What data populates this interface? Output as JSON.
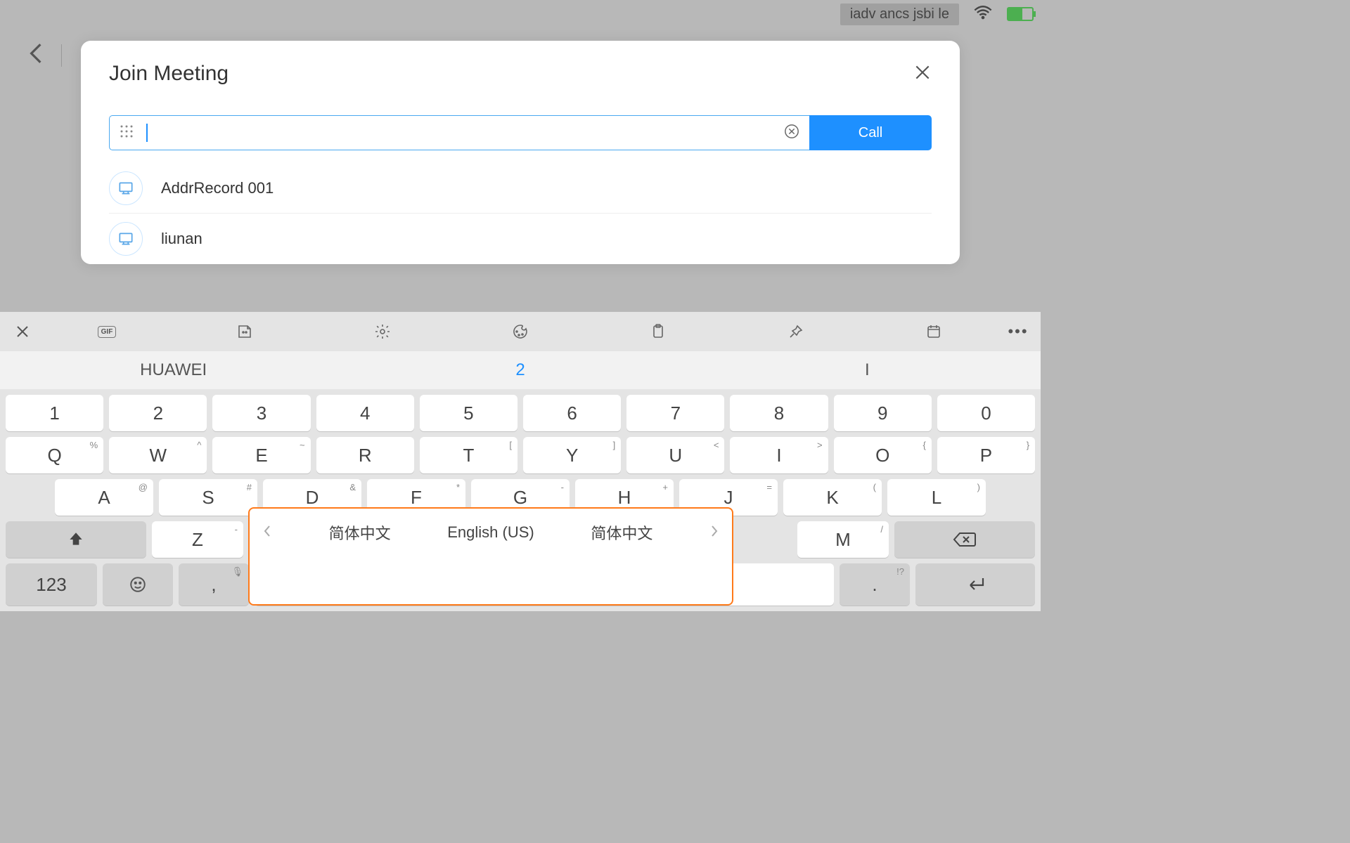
{
  "status": {
    "pill_text": "iadv ancs jsbi le"
  },
  "modal": {
    "title": "Join Meeting",
    "call_label": "Call",
    "contacts": [
      {
        "name": "AddrRecord 001"
      },
      {
        "name": "liunan"
      }
    ]
  },
  "keyboard": {
    "gif_label": "GIF",
    "suggestions": [
      "HUAWEI",
      "2",
      "I"
    ],
    "row_numbers": [
      "1",
      "2",
      "3",
      "4",
      "5",
      "6",
      "7",
      "8",
      "9",
      "0"
    ],
    "row_qwerty": [
      {
        "main": "Q",
        "sup": "%"
      },
      {
        "main": "W",
        "sup": "^"
      },
      {
        "main": "E",
        "sup": "~"
      },
      {
        "main": "R",
        "sup": ""
      },
      {
        "main": "T",
        "sup": "["
      },
      {
        "main": "Y",
        "sup": "]"
      },
      {
        "main": "U",
        "sup": "<"
      },
      {
        "main": "I",
        "sup": ">"
      },
      {
        "main": "O",
        "sup": "{"
      },
      {
        "main": "P",
        "sup": "}"
      }
    ],
    "row_asdf": [
      {
        "main": "A",
        "sup": "@"
      },
      {
        "main": "S",
        "sup": "#"
      },
      {
        "main": "D",
        "sup": "&"
      },
      {
        "main": "F",
        "sup": "*"
      },
      {
        "main": "G",
        "sup": "-"
      },
      {
        "main": "H",
        "sup": "+"
      },
      {
        "main": "J",
        "sup": "="
      },
      {
        "main": "K",
        "sup": "("
      },
      {
        "main": "L",
        "sup": ")"
      }
    ],
    "z_key": {
      "main": "Z",
      "sup": "-"
    },
    "m_key": {
      "main": "M",
      "sup": "/"
    },
    "numsym_label": "123",
    "comma_key": {
      "main": ",",
      "sup": "🎤"
    },
    "dot_key": {
      "main": ".",
      "sup": "!?"
    },
    "lang": {
      "left": "简体中文",
      "center": "English (US)",
      "right": "简体中文"
    }
  }
}
